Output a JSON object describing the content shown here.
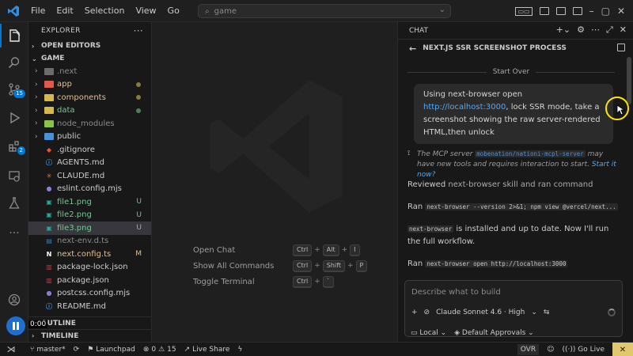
{
  "titlebar": {
    "menu": [
      "File",
      "Edit",
      "Selection",
      "View",
      "Go"
    ],
    "search_text": "game",
    "colors": {
      "logo": "#2f8fe0"
    }
  },
  "activity": {
    "source_control_badge": "15",
    "extensions_badge": "2"
  },
  "explorer": {
    "header": "EXPLORER",
    "open_editors": "OPEN EDITORS",
    "root": "GAME",
    "items": [
      {
        "name": ".next",
        "icon": "folder-gray",
        "type": "folder",
        "color": "#8b8b8b",
        "mark": ""
      },
      {
        "name": "app",
        "icon": "folder-red",
        "type": "folder",
        "color": "#e2c08d",
        "mark": "dot"
      },
      {
        "name": "components",
        "icon": "folder-yellow",
        "type": "folder",
        "color": "#e2c08d",
        "mark": "dot"
      },
      {
        "name": "data",
        "icon": "folder-yellow",
        "type": "folder",
        "color": "#73c991",
        "mark": "dotgreen"
      },
      {
        "name": "node_modules",
        "icon": "folder-green",
        "type": "folder",
        "color": "#8b8b8b",
        "mark": ""
      },
      {
        "name": "public",
        "icon": "folder-blue",
        "type": "folder",
        "color": "#cccccc",
        "mark": ""
      },
      {
        "name": ".gitignore",
        "icon": "git",
        "type": "file",
        "color": "#cccccc",
        "mark": ""
      },
      {
        "name": "AGENTS.md",
        "icon": "info",
        "type": "file",
        "color": "#cccccc",
        "mark": ""
      },
      {
        "name": "CLAUDE.md",
        "icon": "claude",
        "type": "file",
        "color": "#cccccc",
        "mark": ""
      },
      {
        "name": "eslint.config.mjs",
        "icon": "js",
        "type": "file",
        "color": "#cccccc",
        "mark": ""
      },
      {
        "name": "file1.png",
        "icon": "image",
        "type": "file",
        "color": "#73c991",
        "mark": "U"
      },
      {
        "name": "file2.png",
        "icon": "image",
        "type": "file",
        "color": "#73c991",
        "mark": "U"
      },
      {
        "name": "file3.png",
        "icon": "image",
        "type": "file",
        "color": "#73c991",
        "mark": "U"
      },
      {
        "name": "next-env.d.ts",
        "icon": "ts",
        "type": "file",
        "color": "#8b8b8b",
        "mark": ""
      },
      {
        "name": "next.config.ts",
        "icon": "next",
        "type": "file",
        "color": "#e2c08d",
        "mark": "M"
      },
      {
        "name": "package-lock.json",
        "icon": "npm",
        "type": "file",
        "color": "#cccccc",
        "mark": ""
      },
      {
        "name": "package.json",
        "icon": "npm",
        "type": "file",
        "color": "#cccccc",
        "mark": ""
      },
      {
        "name": "postcss.config.mjs",
        "icon": "js",
        "type": "file",
        "color": "#cccccc",
        "mark": ""
      },
      {
        "name": "README.md",
        "icon": "info",
        "type": "file",
        "color": "#cccccc",
        "mark": ""
      }
    ],
    "outline": "OUTLINE",
    "timeline": "TIMELINE"
  },
  "editor": {
    "shortcuts": [
      {
        "label": "Open Chat",
        "keys": [
          "Ctrl",
          "Alt",
          "I"
        ]
      },
      {
        "label": "Show All Commands",
        "keys": [
          "Ctrl",
          "Shift",
          "P"
        ]
      },
      {
        "label": "Toggle Terminal",
        "keys": [
          "Ctrl",
          "`"
        ]
      }
    ]
  },
  "chat": {
    "tab": "CHAT",
    "session_title": "NEXT.JS SSR SCREENSHOT PROCESS",
    "start_over": "Start Over",
    "user_msg_pre": "Using next-browser open ",
    "user_msg_link": "http://localhost:3000",
    "user_msg_post": ", lock SSR mode, take a screenshot showing the raw server-rendered HTML,then unlock",
    "mcp_pre": "The MCP server ",
    "mcp_code": "mobenation/nationi-mcpl-server",
    "mcp_post": " may have new tools and requires interaction to start. ",
    "mcp_link": "Start it now?",
    "reviewed_pre": "Reviewed ",
    "reviewed_post": "next-browser skill and ran command",
    "ran1_pre": "Ran ",
    "ran1_code": "next-browser --version 2>&1; npm view @vercel/next...",
    "installed_code": "next-browser",
    "installed_post": " is installed and up to date. Now I'll run the full workflow.",
    "ran2_pre": "Ran ",
    "ran2_code": "next-browser open http://localhost:3000",
    "input_placeholder": "Describe what to build",
    "model": "Claude Sonnet 4.6 · High",
    "local": "Local",
    "approvals": "Default Approvals"
  },
  "statusbar": {
    "branch": "master*",
    "launchpad": "Launchpad",
    "errors": "0",
    "warnings": "15",
    "live_share": "Live Share",
    "ovr": "OVR",
    "go_live": "Go Live"
  },
  "recording": {
    "time": "0:00"
  }
}
